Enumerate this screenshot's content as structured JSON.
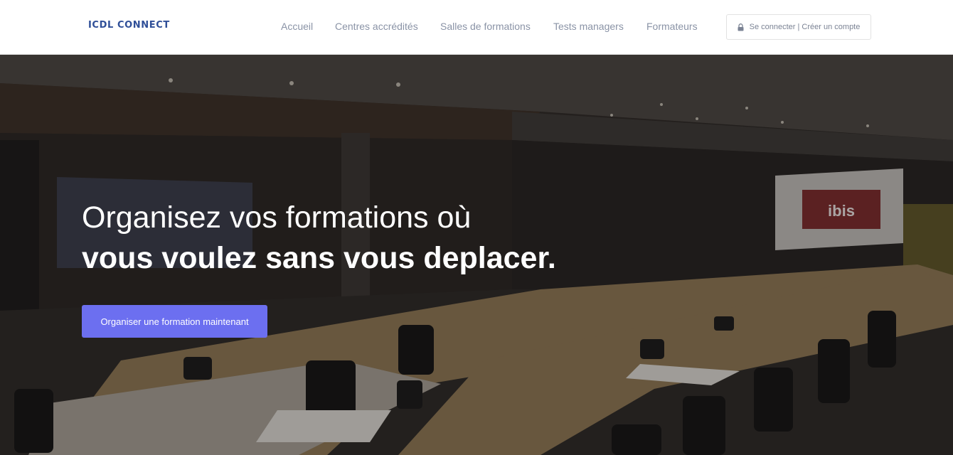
{
  "brand": {
    "name": "ICDL CONNECT"
  },
  "nav": {
    "items": [
      {
        "label": "Accueil"
      },
      {
        "label": "Centres accrédités"
      },
      {
        "label": "Salles de formations"
      },
      {
        "label": "Tests managers"
      },
      {
        "label": "Formateurs"
      }
    ]
  },
  "auth": {
    "label": "Se connecter | Créer un compte",
    "icon": "lock-icon"
  },
  "hero": {
    "headline_line1": "Organisez vos formations où",
    "headline_line2": "vous voulez sans vous deplacer.",
    "cta_label": "Organiser une formation maintenant",
    "background_image": "conference-room-photo",
    "screen_sign": "ibis"
  },
  "colors": {
    "brand": "#2f4f98",
    "nav_text": "#8a93a6",
    "cta": "#6c6ff0",
    "hero_text": "#ffffff"
  }
}
